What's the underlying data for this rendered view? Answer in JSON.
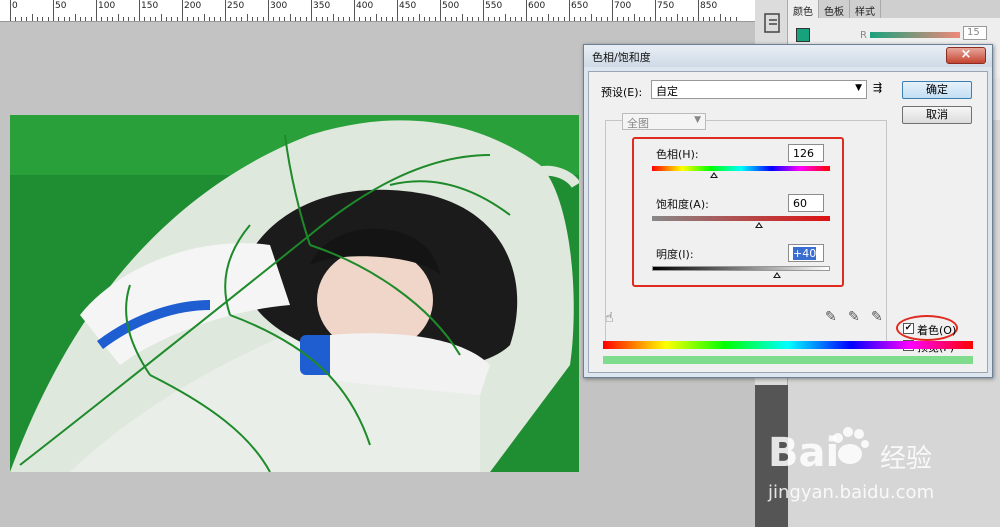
{
  "ruler": {
    "labels": [
      "0",
      "50",
      "100",
      "150",
      "200",
      "250",
      "300",
      "350",
      "400",
      "450",
      "500",
      "550",
      "600",
      "650",
      "700",
      "750",
      "850"
    ]
  },
  "right_panel": {
    "tabs": [
      "颜色",
      "色板",
      "样式"
    ],
    "channel_label": "R",
    "channel_value": "15"
  },
  "dialog": {
    "title": "色相/饱和度",
    "close_label": "×",
    "preset_label": "预设(E):",
    "preset_value": "自定",
    "ok_label": "确定",
    "cancel_label": "取消",
    "range_value": "全图",
    "hue": {
      "label": "色相(H):",
      "value": "126",
      "fraction": 0.35
    },
    "saturation": {
      "label": "饱和度(A):",
      "value": "60",
      "fraction": 0.6
    },
    "lightness": {
      "label": "明度(I):",
      "value": "+40",
      "fraction": 0.7
    },
    "colorize": {
      "label": "着色(O)",
      "checked": true
    },
    "preview": {
      "label": "预览(P)",
      "checked": true
    }
  },
  "colors": {
    "accent_green": "#1f8e32",
    "highlight_red": "#e02b1f",
    "result_bar": "#7fdc8d"
  },
  "watermark": {
    "brand": "Bai",
    "brand_suffix": "经验",
    "url": "jingyan.baidu.com"
  }
}
